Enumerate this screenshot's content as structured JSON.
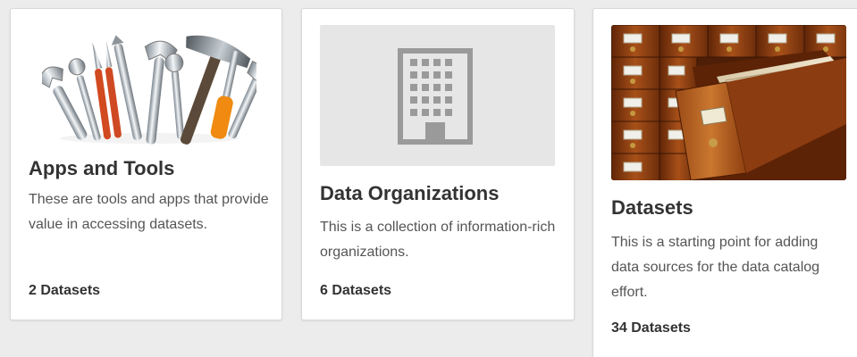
{
  "cards": [
    {
      "title": "Apps and Tools",
      "description": "These are tools and apps that provide value in accessing datasets.",
      "count": "2 Datasets",
      "image_icon": "tools-icon"
    },
    {
      "title": "Data Organizations",
      "description": "This is a collection of information-rich organizations.",
      "count": "6 Datasets",
      "image_icon": "building-icon"
    },
    {
      "title": "Datasets",
      "description": "This is a starting point for adding data sources for the data catalog effort.",
      "count": "34 Datasets",
      "image_icon": "card-catalog-drawer-icon"
    }
  ],
  "colors": {
    "page_background": "#ececec",
    "card_background": "#ffffff",
    "title_text": "#333333",
    "body_text": "#555555",
    "placeholder_background": "#e6e6e6",
    "placeholder_icon": "#9a9a9a"
  }
}
